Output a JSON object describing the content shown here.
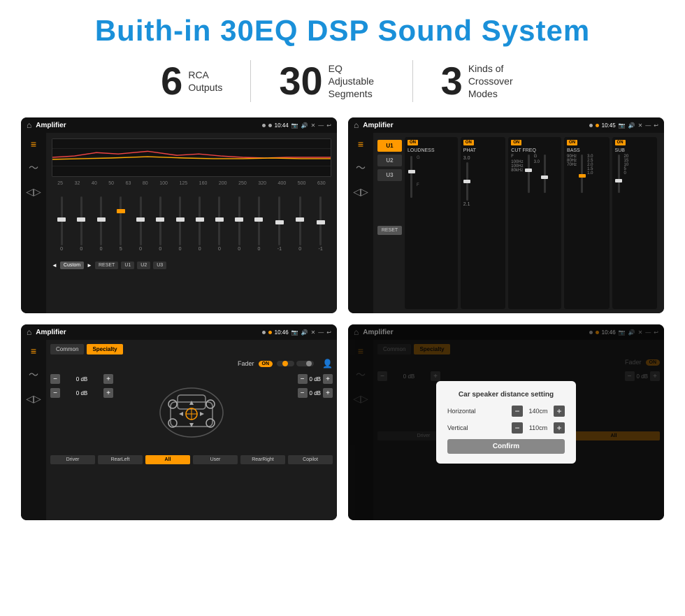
{
  "title": "Buith-in 30EQ DSP Sound System",
  "stats": [
    {
      "number": "6",
      "label": "RCA\nOutputs"
    },
    {
      "number": "30",
      "label": "EQ Adjustable\nSegments"
    },
    {
      "number": "3",
      "label": "Kinds of\nCrossover Modes"
    }
  ],
  "screens": [
    {
      "id": "eq-screen",
      "statusBar": {
        "app": "Amplifier",
        "time": "10:44"
      },
      "type": "eq"
    },
    {
      "id": "crossover-screen",
      "statusBar": {
        "app": "Amplifier",
        "time": "10:45"
      },
      "type": "crossover"
    },
    {
      "id": "fader-screen",
      "statusBar": {
        "app": "Amplifier",
        "time": "10:46"
      },
      "type": "fader"
    },
    {
      "id": "dialog-screen",
      "statusBar": {
        "app": "Amplifier",
        "time": "10:46"
      },
      "type": "dialog",
      "dialog": {
        "title": "Car speaker distance setting",
        "horizontal": {
          "label": "Horizontal",
          "value": "140cm"
        },
        "vertical": {
          "label": "Vertical",
          "value": "110cm"
        },
        "confirmLabel": "Confirm"
      }
    }
  ],
  "eq": {
    "frequencies": [
      "25",
      "32",
      "40",
      "50",
      "63",
      "80",
      "100",
      "125",
      "160",
      "200",
      "250",
      "320",
      "400",
      "500",
      "630"
    ],
    "values": [
      "0",
      "0",
      "0",
      "5",
      "0",
      "0",
      "0",
      "0",
      "0",
      "0",
      "0",
      "-1",
      "0",
      "-1"
    ],
    "presets": [
      "Custom",
      "RESET",
      "U1",
      "U2",
      "U3"
    ]
  },
  "crossover": {
    "presets": [
      "U1",
      "U2",
      "U3"
    ],
    "channels": [
      {
        "id": "loudness",
        "label": "LOUDNESS",
        "on": true
      },
      {
        "id": "phat",
        "label": "PHAT",
        "on": true
      },
      {
        "id": "cutfreq",
        "label": "CUT FREQ",
        "on": true
      },
      {
        "id": "bass",
        "label": "BASS",
        "on": true
      },
      {
        "id": "sub",
        "label": "SUB",
        "on": true
      }
    ],
    "resetLabel": "RESET"
  },
  "fader": {
    "tabs": [
      "Common",
      "Specialty"
    ],
    "faderLabel": "Fader",
    "faderOnLabel": "ON",
    "dbValues": [
      "0 dB",
      "0 dB",
      "0 dB",
      "0 dB"
    ],
    "bottomButtons": [
      "Driver",
      "RearLeft",
      "All",
      "User",
      "RearRight",
      "Copilot"
    ]
  },
  "dialog": {
    "title": "Car speaker distance setting",
    "horizontalLabel": "Horizontal",
    "horizontalValue": "140cm",
    "verticalLabel": "Vertical",
    "verticalValue": "110cm",
    "confirmLabel": "Confirm"
  }
}
